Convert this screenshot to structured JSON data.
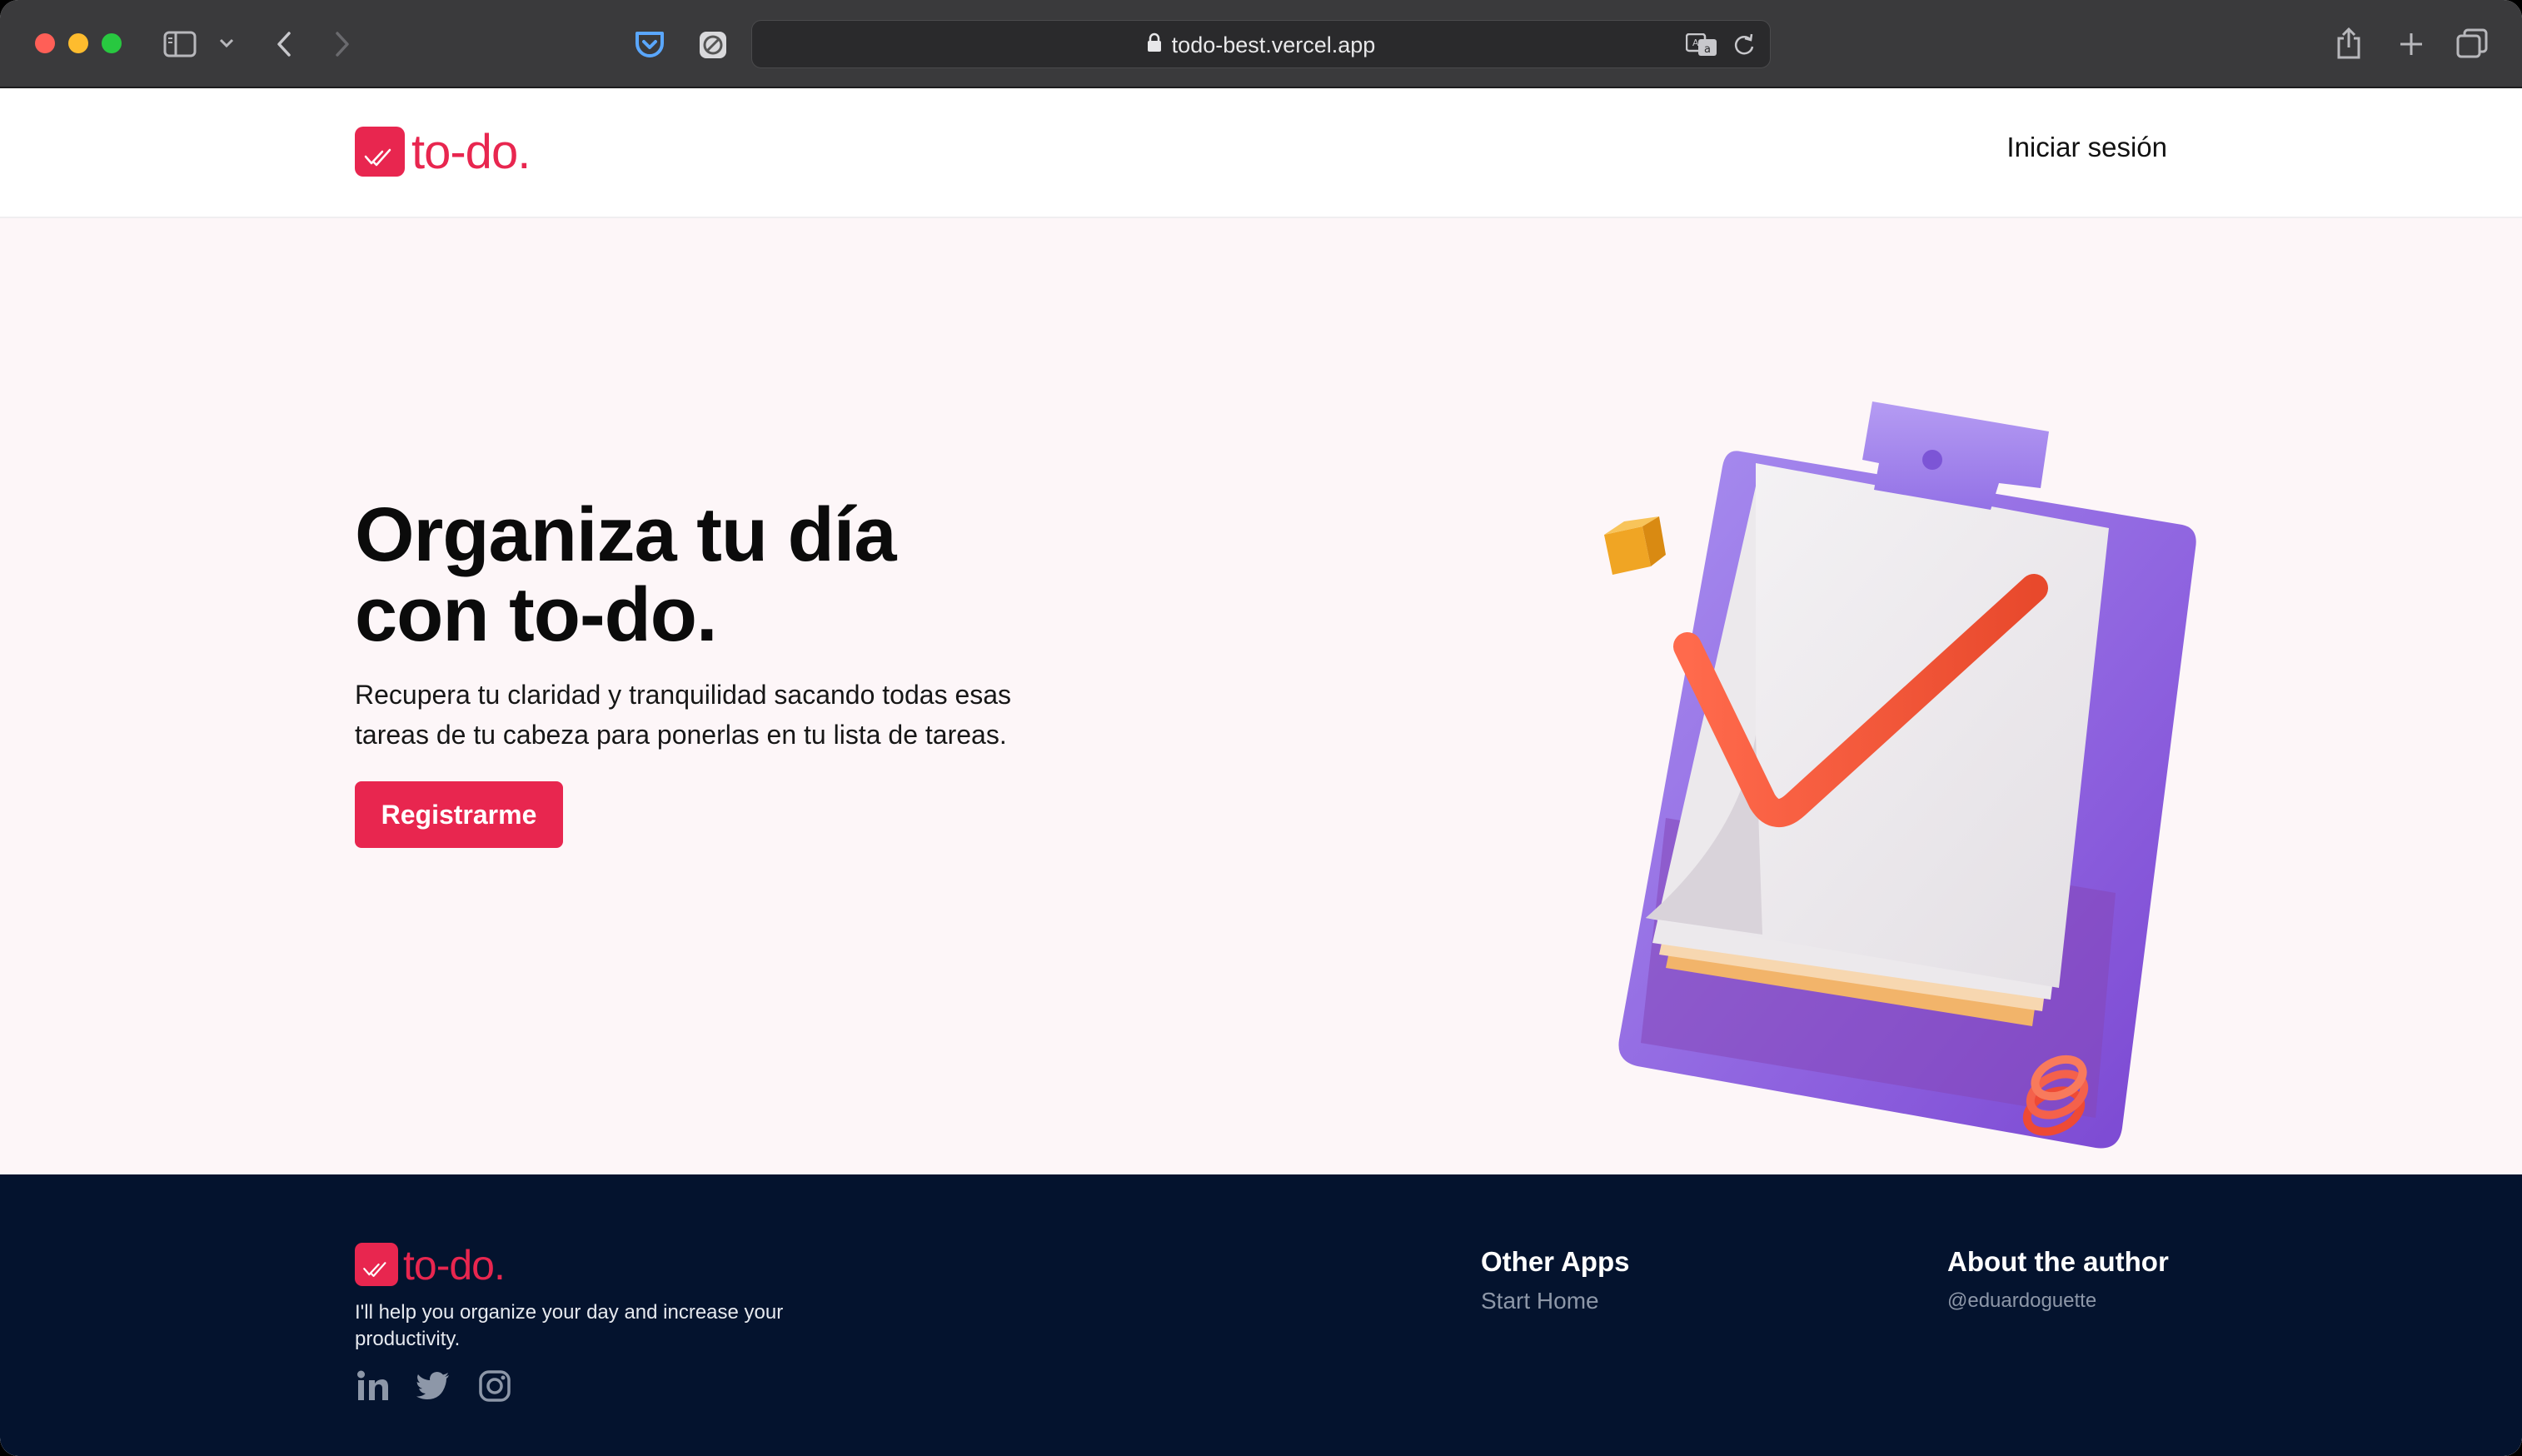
{
  "browser": {
    "url": "todo-best.vercel.app"
  },
  "header": {
    "logo_text": "to-do",
    "logo_dot": ".",
    "login_label": "Iniciar sesión"
  },
  "hero": {
    "title_line1": "Organiza tu día",
    "title_line2": "con to-do.",
    "subtitle_line1": "Recupera tu claridad y tranquilidad sacando todas esas",
    "subtitle_line2": "tareas de tu cabeza para ponerlas en tu lista de tareas.",
    "cta_label": "Registrarme"
  },
  "footer": {
    "logo_text": "to-do",
    "logo_dot": ".",
    "tagline": "I'll help you organize your day and increase your productivity.",
    "social": [
      "linkedin-icon",
      "twitter-icon",
      "instagram-icon"
    ],
    "other_apps_title": "Other Apps",
    "other_apps_link": "Start Home",
    "author_title": "About the author",
    "author_handle": "@eduardoguette"
  },
  "colors": {
    "brand": "#e8264f",
    "footer_bg": "#04132e",
    "hero_bg": "#fdf6f8"
  }
}
